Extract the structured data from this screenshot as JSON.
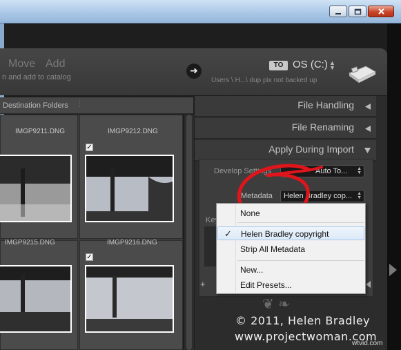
{
  "window": {
    "controls": [
      "minimize-icon",
      "restore-icon",
      "close-icon"
    ]
  },
  "header": {
    "move_label": "Move",
    "add_label": "Add",
    "subtitle": "n and add to catalog",
    "to_badge": "TO",
    "drive_name": "OS (C:)",
    "path": "Users \\ H...\\ dup pix not backed up"
  },
  "destination_folders_label": "Destination Folders",
  "grid": {
    "thumbnails": [
      {
        "filename": "IMGP9211.DNG",
        "checked": false
      },
      {
        "filename": "IMGP9212.DNG",
        "checked": true
      },
      {
        "filename": "IMGP9215.DNG",
        "checked": false
      },
      {
        "filename": "IMGP9216.DNG",
        "checked": true
      }
    ]
  },
  "right_panel": {
    "sections": [
      "File Handling",
      "File Renaming",
      "Apply During Import"
    ],
    "develop_settings_label": "Develop Settings",
    "develop_settings_value": "Auto To...",
    "metadata_label": "Metadata",
    "metadata_value": "Helen Bradley cop...",
    "keywords_label_fragment": "Key",
    "plus_label": "+"
  },
  "metadata_menu": {
    "items": [
      {
        "label": "None",
        "checked": false
      },
      {
        "label": "Helen Bradley copyright",
        "checked": true
      },
      {
        "label": "Strip All Metadata",
        "checked": false
      },
      {
        "label": "New...",
        "checked": false
      },
      {
        "label": "Edit Presets...",
        "checked": false
      }
    ]
  },
  "watermark": {
    "line1": "© 2011, Helen Bradley",
    "line2": "www.projectwoman.com",
    "site": "wtvid.com"
  },
  "colors": {
    "annotation_red": "#e0151c",
    "panel_bg": "#2c2c2c",
    "menu_bg": "#f1f1f1"
  }
}
